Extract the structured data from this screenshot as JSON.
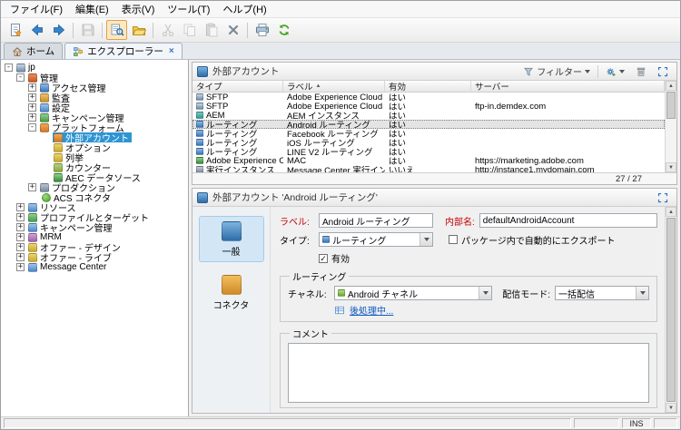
{
  "colors": {
    "tree_selection": "#2e95d3",
    "field_label_red": "#c00000",
    "link_blue": "#0a58c0",
    "toolbar_active_bg": "#ffe8c0"
  },
  "menubar": {
    "items": [
      {
        "name": "file-menu",
        "label": "ファイル(F)"
      },
      {
        "name": "edit-menu",
        "label": "編集(E)"
      },
      {
        "name": "view-menu",
        "label": "表示(V)"
      },
      {
        "name": "tools-menu",
        "label": "ツール(T)"
      },
      {
        "name": "help-menu",
        "label": "ヘルプ(H)"
      }
    ]
  },
  "toolbar": {
    "buttons": [
      {
        "name": "new-button",
        "icon": "new-icon"
      },
      {
        "name": "back-button",
        "icon": "arrow-left-icon"
      },
      {
        "name": "forward-button",
        "icon": "arrow-right-icon"
      },
      {
        "sep": true
      },
      {
        "name": "save-button",
        "icon": "save-icon",
        "disabled": true
      },
      {
        "sep": true
      },
      {
        "name": "preview-toggle-button",
        "icon": "preview-icon",
        "active": true
      },
      {
        "name": "open-folder-button",
        "icon": "folder-icon"
      },
      {
        "sep": true
      },
      {
        "name": "cut-button",
        "icon": "cut-icon",
        "disabled": true
      },
      {
        "name": "copy-button",
        "icon": "copy-icon",
        "disabled": true
      },
      {
        "name": "paste-button",
        "icon": "paste-icon",
        "disabled": true
      },
      {
        "name": "delete-button",
        "icon": "delete-icon"
      },
      {
        "sep": true
      },
      {
        "name": "print-button",
        "icon": "print-icon"
      },
      {
        "name": "refresh-button",
        "icon": "refresh-icon"
      }
    ]
  },
  "tab_bar": {
    "tabs": [
      {
        "name": "tab-home",
        "label": "ホーム",
        "icon": "home-icon",
        "active": false,
        "closable": false
      },
      {
        "name": "tab-explorer",
        "label": "エクスプローラー",
        "icon": "explorer-icon",
        "active": true,
        "closable": true
      }
    ]
  },
  "tree": {
    "items": [
      {
        "name": "jp-root",
        "label": "jp",
        "icon": "server-icon",
        "depth": 0,
        "expander": "minus",
        "selected": false
      },
      {
        "name": "administration",
        "label": "管理",
        "icon": "toolbox-icon",
        "depth": 1,
        "expander": "minus",
        "selected": false
      },
      {
        "name": "access-management",
        "label": "アクセス管理",
        "icon": "access-icon",
        "depth": 2,
        "expander": "plus",
        "selected": false
      },
      {
        "name": "audit",
        "label": "監査",
        "icon": "audit-icon",
        "depth": 2,
        "expander": "plus",
        "selected": false
      },
      {
        "name": "configuration",
        "label": "設定",
        "icon": "settings-icon",
        "depth": 2,
        "expander": "plus",
        "selected": false
      },
      {
        "name": "campaign-management-admin",
        "label": "キャンペーン管理",
        "icon": "campaign-admin-icon",
        "depth": 2,
        "expander": "plus",
        "selected": false
      },
      {
        "name": "platform",
        "label": "プラットフォーム",
        "icon": "platform-icon",
        "depth": 2,
        "expander": "minus",
        "selected": false
      },
      {
        "name": "external-accounts",
        "label": "外部アカウント",
        "icon": "external-account-icon",
        "depth": 3,
        "expander": "none",
        "selected": true
      },
      {
        "name": "options",
        "label": "オプション",
        "icon": "options-icon",
        "depth": 3,
        "expander": "none",
        "selected": false
      },
      {
        "name": "enumerations",
        "label": "列挙",
        "icon": "enum-icon",
        "depth": 3,
        "expander": "none",
        "selected": false
      },
      {
        "name": "counters",
        "label": "カウンター",
        "icon": "counter-icon",
        "depth": 3,
        "expander": "none",
        "selected": false
      },
      {
        "name": "aec-data-sources",
        "label": "AEC データソース",
        "icon": "datasource-icon",
        "depth": 3,
        "expander": "none",
        "selected": false
      },
      {
        "name": "production",
        "label": "プロダクション",
        "icon": "production-icon",
        "depth": 2,
        "expander": "plus",
        "selected": false
      },
      {
        "name": "acs-connector",
        "label": "ACS コネクタ",
        "icon": "acs-connector-icon",
        "depth": 2,
        "expander": "none",
        "selected": false
      },
      {
        "name": "resources",
        "label": "リソース",
        "icon": "resources-icon",
        "depth": 1,
        "expander": "plus",
        "selected": false
      },
      {
        "name": "profiles-and-targets",
        "label": "プロファイルとターゲット",
        "icon": "profiles-icon",
        "depth": 1,
        "expander": "plus",
        "selected": false
      },
      {
        "name": "campaign-management",
        "label": "キャンペーン管理",
        "icon": "campaign-icon",
        "depth": 1,
        "expander": "plus",
        "selected": false
      },
      {
        "name": "mrm",
        "label": "MRM",
        "icon": "mrm-icon",
        "depth": 1,
        "expander": "plus",
        "selected": false
      },
      {
        "name": "offers-design",
        "label": "オファー - デザイン",
        "icon": "offers-design-icon",
        "depth": 1,
        "expander": "plus",
        "selected": false
      },
      {
        "name": "offers-live",
        "label": "オファー - ライブ",
        "icon": "offers-live-icon",
        "depth": 1,
        "expander": "plus",
        "selected": false
      },
      {
        "name": "message-center",
        "label": "Message Center",
        "icon": "message-center-icon",
        "depth": 1,
        "expander": "plus",
        "selected": false
      }
    ]
  },
  "list_panel": {
    "title": "外部アカウント",
    "filter_label": "フィルター",
    "count": "27 / 27",
    "columns": [
      {
        "name": "col-type",
        "label": "タイプ",
        "sort": false
      },
      {
        "name": "col-label",
        "label": "ラベル",
        "sort": true
      },
      {
        "name": "col-enabled",
        "label": "有効",
        "sort": false
      },
      {
        "name": "col-server",
        "label": "サーバー",
        "sort": false
      }
    ],
    "rows": [
      {
        "icon": "sftp-icon",
        "type": "SFTP",
        "label": "Adobe Experience Cloud ...",
        "enabled": "はい",
        "server": "",
        "selected": false
      },
      {
        "icon": "sftp-icon",
        "type": "SFTP",
        "label": "Adobe Experience Cloud ...",
        "enabled": "はい",
        "server": "ftp-in.demdex.com",
        "selected": false
      },
      {
        "icon": "aem-icon",
        "type": "AEM",
        "label": "AEM インスタンス",
        "enabled": "はい",
        "server": "",
        "selected": false
      },
      {
        "icon": "routing-icon",
        "type": "ルーティング",
        "label": "Android ルーティング",
        "enabled": "はい",
        "server": "",
        "selected": true
      },
      {
        "icon": "routing-icon",
        "type": "ルーティング",
        "label": "Facebook ルーティング",
        "enabled": "はい",
        "server": "",
        "selected": false
      },
      {
        "icon": "routing-icon",
        "type": "ルーティング",
        "label": "iOS ルーティング",
        "enabled": "はい",
        "server": "",
        "selected": false
      },
      {
        "icon": "routing-icon",
        "type": "ルーティング",
        "label": "LINE V2 ルーティング",
        "enabled": "はい",
        "server": "",
        "selected": false
      },
      {
        "icon": "aec-icon",
        "type": "Adobe Experience Cl...",
        "label": "MAC",
        "enabled": "はい",
        "server": "https://marketing.adobe.com",
        "selected": false
      },
      {
        "icon": "exec-instance-icon",
        "type": "実行インスタンス",
        "label": "Message Center 実行インス...",
        "enabled": "いいえ",
        "server": "http://instance1.mydomain.com",
        "selected": false
      }
    ]
  },
  "detail_panel": {
    "title": "外部アカウント 'Android ルーティング'",
    "tabs": [
      {
        "name": "tab-general",
        "label": "一般",
        "icon": "general-icon",
        "selected": true
      },
      {
        "name": "tab-connector",
        "label": "コネクタ",
        "icon": "connector-tab-icon",
        "selected": false
      }
    ],
    "fields": {
      "label": {
        "caption": "ラベル:",
        "value": "Android ルーティング"
      },
      "internal_name": {
        "caption": "内部名:",
        "value": "defaultAndroidAccount"
      },
      "type": {
        "caption": "タイプ:",
        "value": "ルーティング"
      },
      "enabled": {
        "caption": "有効",
        "checked": true
      },
      "auto_export": {
        "caption": "パッケージ内で自動的にエクスポート",
        "checked": false
      }
    },
    "routing_group": {
      "title": "ルーティング",
      "channel": {
        "caption": "チャネル:",
        "value": "Android チャネル"
      },
      "delivery_mode": {
        "caption": "配信モード:",
        "value": "一括配信"
      },
      "post_processing_link": "後処理中..."
    },
    "comment_group": {
      "title": "コメント",
      "value": ""
    }
  },
  "statusbar": {
    "ins_label": "INS"
  }
}
